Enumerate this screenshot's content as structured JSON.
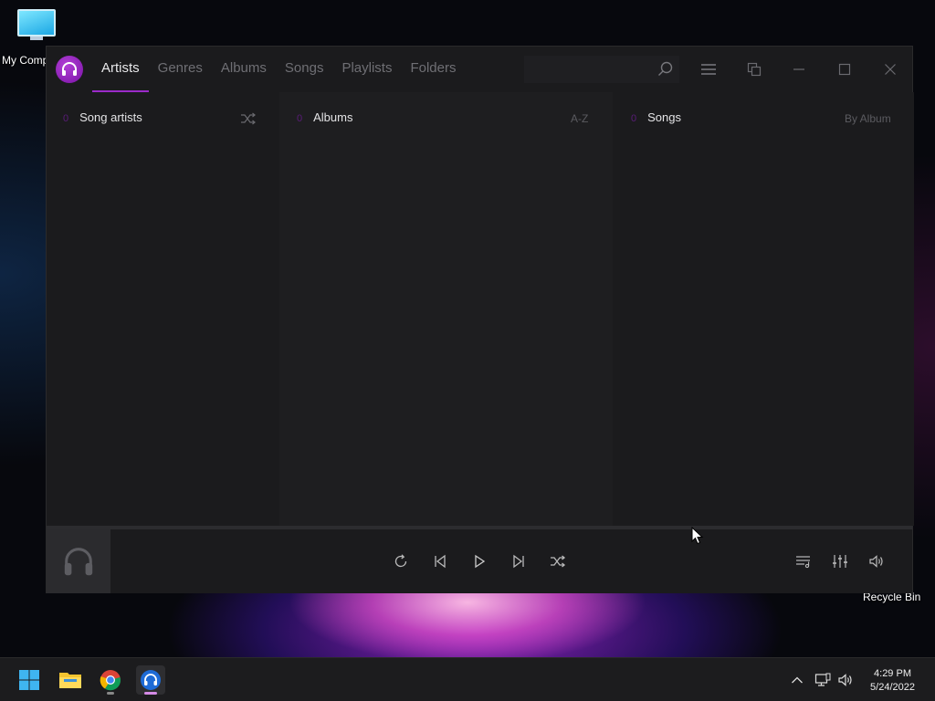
{
  "desktop": {
    "icons": [
      {
        "label": "My Comp"
      },
      {
        "label": "Recycle Bin"
      }
    ]
  },
  "app": {
    "tabs": [
      {
        "label": "Artists",
        "active": true
      },
      {
        "label": "Genres",
        "active": false
      },
      {
        "label": "Albums",
        "active": false
      },
      {
        "label": "Songs",
        "active": false
      },
      {
        "label": "Playlists",
        "active": false
      },
      {
        "label": "Folders",
        "active": false
      }
    ],
    "search": {
      "placeholder": "",
      "value": ""
    },
    "panels": {
      "artists": {
        "count": "0",
        "title": "Song artists"
      },
      "albums": {
        "count": "0",
        "title": "Albums",
        "sort": "A-Z"
      },
      "songs": {
        "count": "0",
        "title": "Songs",
        "sort": "By Album"
      }
    },
    "accent": "#9b2bc9"
  },
  "taskbar": {
    "time": "4:29 PM",
    "date": "5/24/2022"
  }
}
